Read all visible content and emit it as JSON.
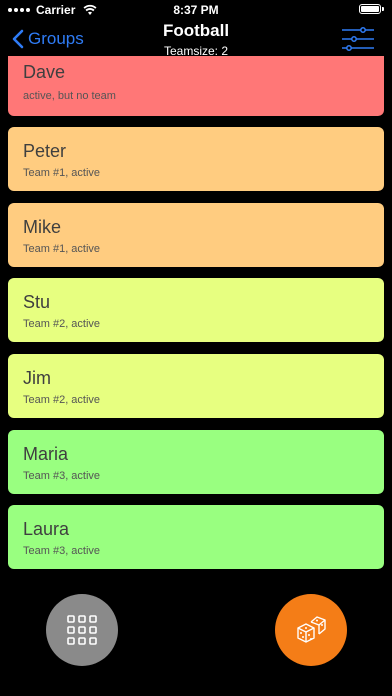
{
  "status_bar": {
    "carrier": "Carrier",
    "time": "8:37 PM",
    "icons": [
      "signal-icon",
      "wifi-icon",
      "battery-icon"
    ]
  },
  "nav": {
    "back_label": "Groups",
    "title": "Football",
    "subtitle": "Teamsize: 2",
    "settings_icon": "sliders-icon"
  },
  "players": [
    {
      "name": "Dave",
      "status": "active, but no team",
      "color": "#ff7777"
    },
    {
      "name": "Peter",
      "status": "Team #1, active",
      "color": "#ffcc80"
    },
    {
      "name": "Mike",
      "status": "Team #1, active",
      "color": "#ffcc80"
    },
    {
      "name": "Stu",
      "status": "Team #2, active",
      "color": "#e7ff80"
    },
    {
      "name": "Jim",
      "status": "Team #2, active",
      "color": "#e7ff80"
    },
    {
      "name": "Maria",
      "status": "Team #3, active",
      "color": "#99ff80"
    },
    {
      "name": "Laura",
      "status": "Team #3, active",
      "color": "#99ff80"
    }
  ],
  "buttons": {
    "grid_icon": "grid-icon",
    "dice_icon": "dice-icon",
    "grid_color": "#8a8a8a",
    "dice_color": "#f47d17"
  },
  "colors": {
    "accent": "#2f7cf6",
    "background": "#000000"
  }
}
